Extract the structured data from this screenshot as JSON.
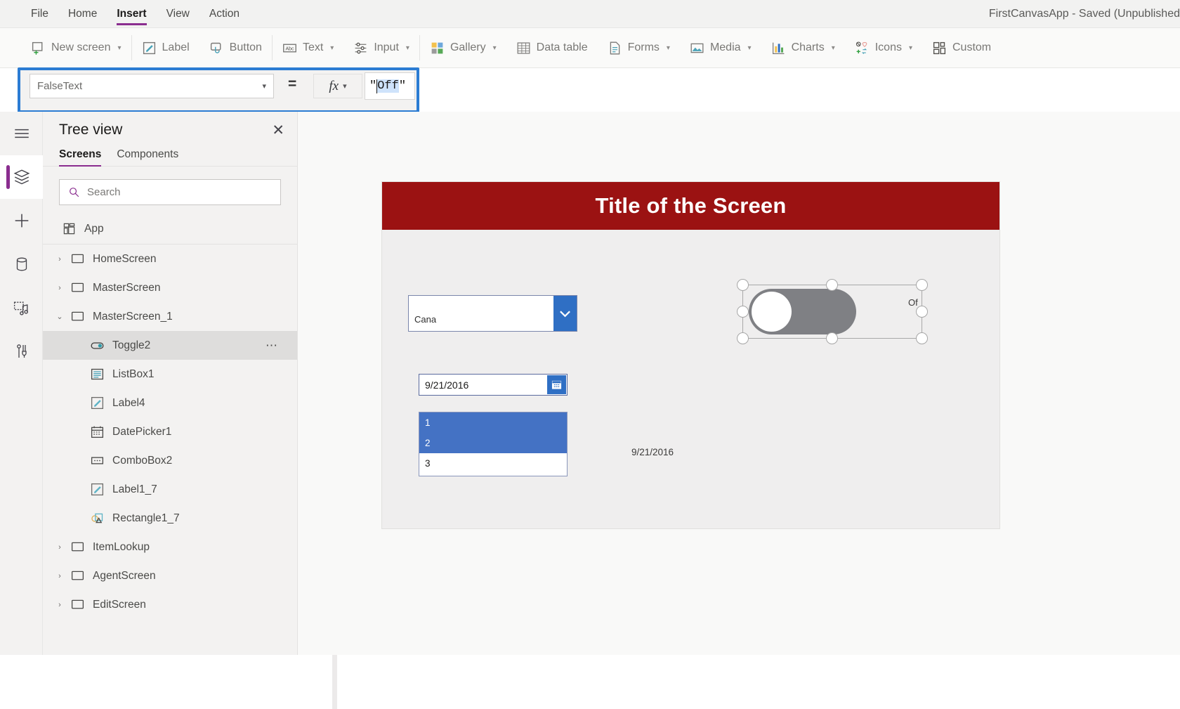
{
  "app": {
    "title": "FirstCanvasApp - Saved (Unpublished"
  },
  "menu": {
    "items": [
      {
        "label": "File",
        "active": false
      },
      {
        "label": "Home",
        "active": false
      },
      {
        "label": "Insert",
        "active": true
      },
      {
        "label": "View",
        "active": false
      },
      {
        "label": "Action",
        "active": false
      }
    ]
  },
  "ribbon": {
    "items": [
      {
        "label": "New screen",
        "icon": "new-screen-icon",
        "caret": true
      },
      {
        "label": "Label",
        "icon": "label-icon",
        "caret": false
      },
      {
        "label": "Button",
        "icon": "button-icon",
        "caret": false
      },
      {
        "label": "Text",
        "icon": "text-icon",
        "caret": true
      },
      {
        "label": "Input",
        "icon": "input-icon",
        "caret": true
      },
      {
        "label": "Gallery",
        "icon": "gallery-icon",
        "caret": true
      },
      {
        "label": "Data table",
        "icon": "data-table-icon",
        "caret": false
      },
      {
        "label": "Forms",
        "icon": "forms-icon",
        "caret": true
      },
      {
        "label": "Media",
        "icon": "media-icon",
        "caret": true
      },
      {
        "label": "Charts",
        "icon": "charts-icon",
        "caret": true
      },
      {
        "label": "Icons",
        "icon": "icons-icon",
        "caret": true
      },
      {
        "label": "Custom",
        "icon": "custom-icon",
        "caret": false
      }
    ]
  },
  "formula_bar": {
    "property": "FalseText",
    "equals": "=",
    "fx": "fx",
    "value_prefix": "\"",
    "value_selected": "Off",
    "value_suffix": "\""
  },
  "rail": {
    "items": [
      {
        "name": "hamburger-menu-icon",
        "selected": false
      },
      {
        "name": "tree-view-icon",
        "selected": true
      },
      {
        "name": "insert-plus-icon",
        "selected": false
      },
      {
        "name": "data-sources-icon",
        "selected": false
      },
      {
        "name": "media-library-icon",
        "selected": false
      },
      {
        "name": "advanced-tools-icon",
        "selected": false
      }
    ]
  },
  "tree_view": {
    "title": "Tree view",
    "close": "✕",
    "tabs": [
      {
        "label": "Screens",
        "active": true
      },
      {
        "label": "Components",
        "active": false
      }
    ],
    "search_placeholder": "Search",
    "app_node": "App",
    "nodes": [
      {
        "label": "HomeScreen",
        "icon": "screen-icon",
        "twisty": "›",
        "child": false,
        "selected": false,
        "dots": false
      },
      {
        "label": "MasterScreen",
        "icon": "screen-icon",
        "twisty": "›",
        "child": false,
        "selected": false,
        "dots": false
      },
      {
        "label": "MasterScreen_1",
        "icon": "screen-icon",
        "twisty": "⌄",
        "child": false,
        "selected": false,
        "dots": false
      },
      {
        "label": "Toggle2",
        "icon": "toggle-icon",
        "twisty": "",
        "child": true,
        "selected": true,
        "dots": true
      },
      {
        "label": "ListBox1",
        "icon": "listbox-icon",
        "twisty": "",
        "child": true,
        "selected": false,
        "dots": false
      },
      {
        "label": "Label4",
        "icon": "label-icon",
        "twisty": "",
        "child": true,
        "selected": false,
        "dots": false
      },
      {
        "label": "DatePicker1",
        "icon": "calendar-icon",
        "twisty": "",
        "child": true,
        "selected": false,
        "dots": false
      },
      {
        "label": "ComboBox2",
        "icon": "combobox-icon",
        "twisty": "",
        "child": true,
        "selected": false,
        "dots": false
      },
      {
        "label": "Label1_7",
        "icon": "label-icon",
        "twisty": "",
        "child": true,
        "selected": false,
        "dots": false
      },
      {
        "label": "Rectangle1_7",
        "icon": "shape-icon",
        "twisty": "",
        "child": true,
        "selected": false,
        "dots": false
      },
      {
        "label": "ItemLookup",
        "icon": "screen-icon",
        "twisty": "›",
        "child": false,
        "selected": false,
        "dots": false
      },
      {
        "label": "AgentScreen",
        "icon": "screen-icon",
        "twisty": "›",
        "child": false,
        "selected": false,
        "dots": false
      },
      {
        "label": "EditScreen",
        "icon": "screen-icon",
        "twisty": "›",
        "child": false,
        "selected": false,
        "dots": false
      }
    ]
  },
  "canvas": {
    "screen_title": "Title of the Screen",
    "title_bar_color": "#9b1212",
    "combobox": {
      "value": "Cana",
      "button_color": "#2f6fc4"
    },
    "datepicker": {
      "value": "9/21/2016",
      "button_color": "#2f6fc4"
    },
    "date_label": "9/21/2016",
    "listbox": {
      "items": [
        {
          "text": "1",
          "selected": true
        },
        {
          "text": "2",
          "selected": true
        },
        {
          "text": "3",
          "selected": false
        }
      ]
    },
    "toggle": {
      "state_label": "Of",
      "track_color": "#7f8084"
    }
  }
}
